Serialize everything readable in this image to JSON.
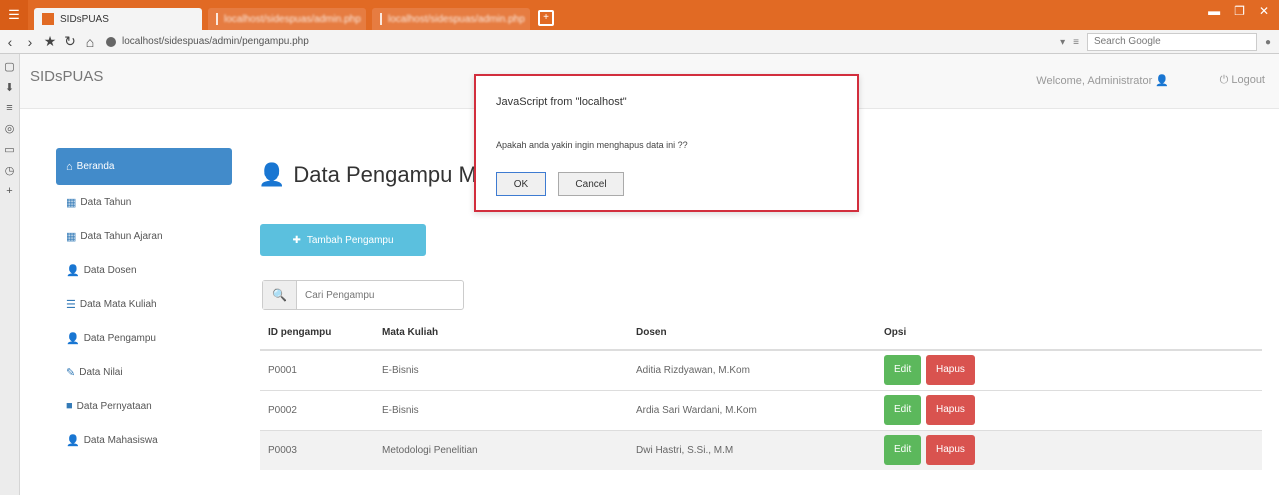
{
  "browser": {
    "tab_active": "SIDsPUAS",
    "tab2": "localhost/sidespuas/admin.php",
    "tab3": "localhost/sidespuas/admin.php",
    "url": "localhost/sidespuas/admin/pengampu.php",
    "search_placeholder": "Search Google"
  },
  "header": {
    "brand": "SIDsPUAS",
    "welcome": "Welcome, Administrator",
    "logout": "Logout"
  },
  "menu": {
    "items": [
      {
        "label": "Beranda",
        "icon": "home-icon"
      },
      {
        "label": "Data Tahun",
        "icon": "table-icon"
      },
      {
        "label": "Data Tahun Ajaran",
        "icon": "table-icon"
      },
      {
        "label": "Data Dosen",
        "icon": "user-icon"
      },
      {
        "label": "Data Mata Kuliah",
        "icon": "list-icon"
      },
      {
        "label": "Data Pengampu",
        "icon": "user-icon"
      },
      {
        "label": "Data Nilai",
        "icon": "pencil-icon"
      },
      {
        "label": "Data Pernyataan",
        "icon": "square-icon"
      },
      {
        "label": "Data Mahasiswa",
        "icon": "user-icon"
      }
    ]
  },
  "main": {
    "title": "Data Pengampu M",
    "add_button": "Tambah Pengampu",
    "search_placeholder": "Cari Pengampu",
    "columns": [
      "ID pengampu",
      "Mata Kuliah",
      "Dosen",
      "Opsi"
    ],
    "rows": [
      {
        "id": "P0001",
        "matkul": "E-Bisnis",
        "dosen": "Aditia Rizdyawan, M.Kom"
      },
      {
        "id": "P0002",
        "matkul": "E-Bisnis",
        "dosen": "Ardia Sari Wardani, M.Kom"
      },
      {
        "id": "P0003",
        "matkul": "Metodologi Penelitian",
        "dosen": "Dwi Hastri, S.Si., M.M"
      }
    ],
    "edit_label": "Edit",
    "delete_label": "Hapus"
  },
  "dialog": {
    "title": "JavaScript from \"localhost\"",
    "message": "Apakah anda yakin ingin menghapus data ini ??",
    "ok": "OK",
    "cancel": "Cancel"
  },
  "colors": {
    "titlebar": "#e16a24",
    "active_menu": "#428bca",
    "add_button": "#5bc0de",
    "edit": "#5cb85c",
    "delete": "#d9534f",
    "dialog_border": "#d22e3d"
  }
}
